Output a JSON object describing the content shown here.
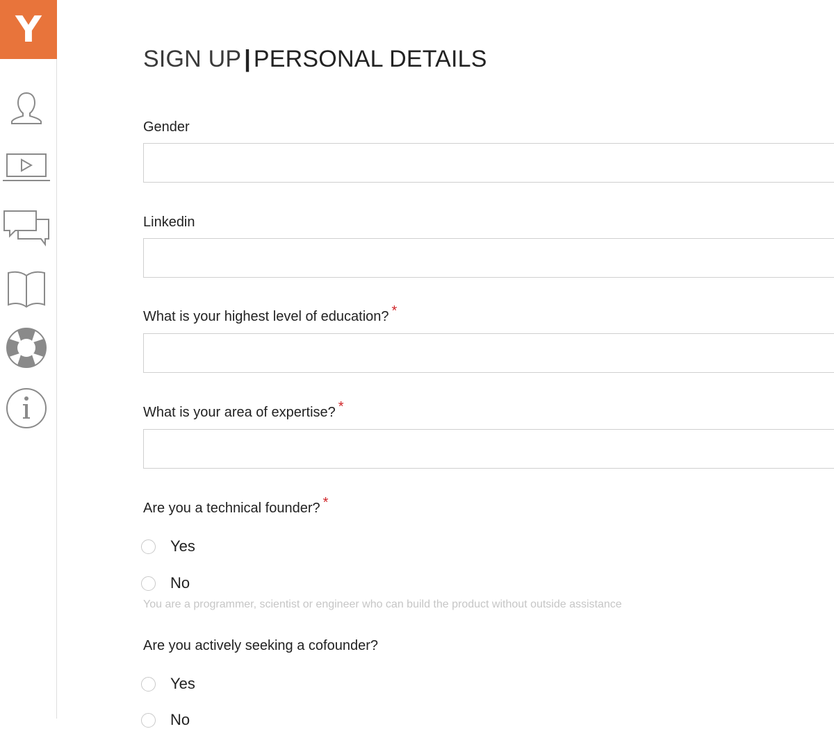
{
  "sidebar": {
    "logo_letter": "Y",
    "accent_color": "#e8743b",
    "items": [
      {
        "icon": "user-icon"
      },
      {
        "icon": "video-icon"
      },
      {
        "icon": "chat-icon"
      },
      {
        "icon": "book-icon"
      },
      {
        "icon": "lifebuoy-icon"
      },
      {
        "icon": "info-icon"
      }
    ]
  },
  "header": {
    "title_left": "SIGN UP",
    "title_sep": "|",
    "title_right": "PERSONAL DETAILS"
  },
  "form": {
    "gender": {
      "label": "Gender",
      "value": ""
    },
    "linkedin": {
      "label": "Linkedin",
      "value": ""
    },
    "education": {
      "label": "What is your highest level of education?",
      "required_mark": "*",
      "value": ""
    },
    "expertise": {
      "label": "What is your area of expertise?",
      "required_mark": "*",
      "value": ""
    },
    "technical_founder": {
      "label": "Are you a technical founder?",
      "required_mark": "*",
      "options": [
        "Yes",
        "No"
      ],
      "help": "You are a programmer, scientist or engineer who can build the product without outside assistance"
    },
    "seeking_cofounder": {
      "label": "Are you actively seeking a cofounder?",
      "options": [
        "Yes",
        "No"
      ]
    }
  },
  "colors": {
    "required": "#d0262a",
    "border": "#cfcfcf",
    "help_text": "#c6c6c6"
  }
}
